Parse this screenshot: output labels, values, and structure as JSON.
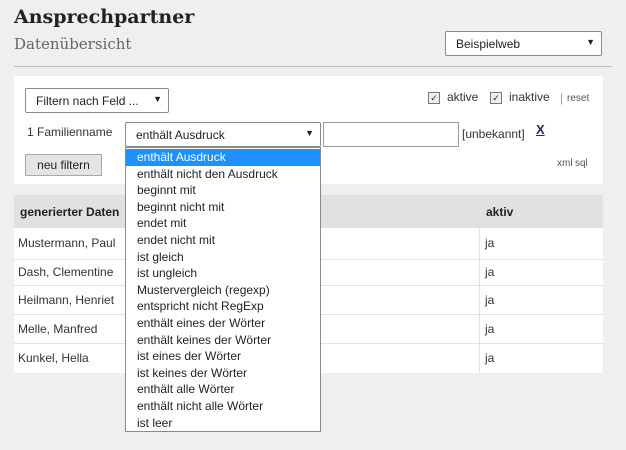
{
  "header": {
    "title": "Ansprechpartner",
    "subtitle": "Datenübersicht",
    "site_select": "Beispielweb"
  },
  "filter": {
    "field_select": "Filtern nach Feld ...",
    "active_label": "aktive",
    "inactive_label": "inaktive",
    "separator": "|",
    "reset_label": "reset",
    "row_label": "1 Familienname",
    "condition_selected": "enthält Ausdruck",
    "value": "",
    "unknown_label": "[unbekannt]",
    "remove_label": "X",
    "submit_label": "neu filtern",
    "export_xml": "xml",
    "export_sql": "sql"
  },
  "dropdown": {
    "options": [
      "enthält Ausdruck",
      "enthält nicht den Ausdruck",
      "beginnt mit",
      "beginnt nicht mit",
      "endet mit",
      "endet nicht mit",
      "ist gleich",
      "ist ungleich",
      "Mustervergleich (regexp)",
      "entspricht nicht RegExp",
      "enthält eines der Wörter",
      "enthält keines der Wörter",
      "ist eines der Wörter",
      "ist keines der Wörter",
      "enthält alle Wörter",
      "enthält nicht alle Wörter",
      "ist leer"
    ],
    "selected_index": 0
  },
  "table": {
    "columns": [
      "generierter Daten",
      "aktiv"
    ],
    "rows": [
      {
        "name": "Mustermann, Paul",
        "aktiv": "ja"
      },
      {
        "name": "Dash, Clementine",
        "aktiv": "ja"
      },
      {
        "name": "Heilmann, Henriet",
        "aktiv": "ja"
      },
      {
        "name": "Melle, Manfred",
        "aktiv": "ja"
      },
      {
        "name": "Kunkel, Hella",
        "aktiv": "ja"
      }
    ]
  },
  "colors": {
    "selected_option_bg": "#1e90ff",
    "table_header_bg": "#e1e1e1",
    "page_bg": "#efefef"
  }
}
